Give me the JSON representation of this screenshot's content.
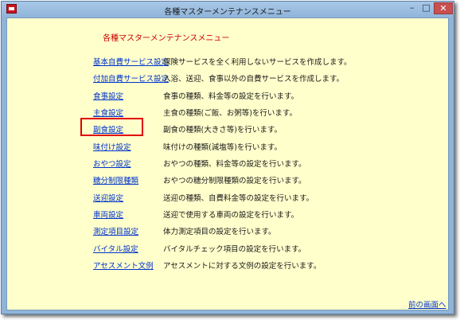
{
  "window": {
    "title": "各種マスターメンテナンスメニュー",
    "controls": {
      "minimize": "–",
      "maximize": "□",
      "close": "✕"
    }
  },
  "heading": "各種マスターメンテナンスメニュー",
  "menu": [
    {
      "label": "基本自費サービス設定",
      "description": "保険サービスを全く利用しないサービスを作成します。"
    },
    {
      "label": "付加自費サービス設定",
      "description": "入浴、送迎、食事以外の自費サービスを作成します。"
    },
    {
      "label": "食事設定",
      "description": "食事の種類、料金等の設定を行います。"
    },
    {
      "label": "主食設定",
      "description": "主食の種類(ご飯、お粥等)を行います。"
    },
    {
      "label": "副食設定",
      "description": "副食の種類(大きさ等)を行います。"
    },
    {
      "label": "味付け設定",
      "description": "味付けの種類(減塩等)を行います。"
    },
    {
      "label": "おやつ設定",
      "description": "おやつの種類、料金等の設定を行います。"
    },
    {
      "label": "糖分制限種類",
      "description": "おやつの糖分制限種類の設定を行います。"
    },
    {
      "label": "送迎設定",
      "description": "送迎の種類、自費料金等の設定を行います。"
    },
    {
      "label": "車両設定",
      "description": "送迎で使用する車両の設定を行います。"
    },
    {
      "label": "測定項目設定",
      "description": "体力測定項目の設定を行います。"
    },
    {
      "label": "バイタル設定",
      "description": "バイタルチェック項目の設定を行います。"
    },
    {
      "label": "アセスメント文例",
      "description": "アセスメントに対する文例の設定を行います。"
    }
  ],
  "back_link": "前の画面へ",
  "colors": {
    "link": "#0033cc",
    "heading": "#cc0000",
    "highlight": "#e00000",
    "background": "#ffffcc"
  }
}
